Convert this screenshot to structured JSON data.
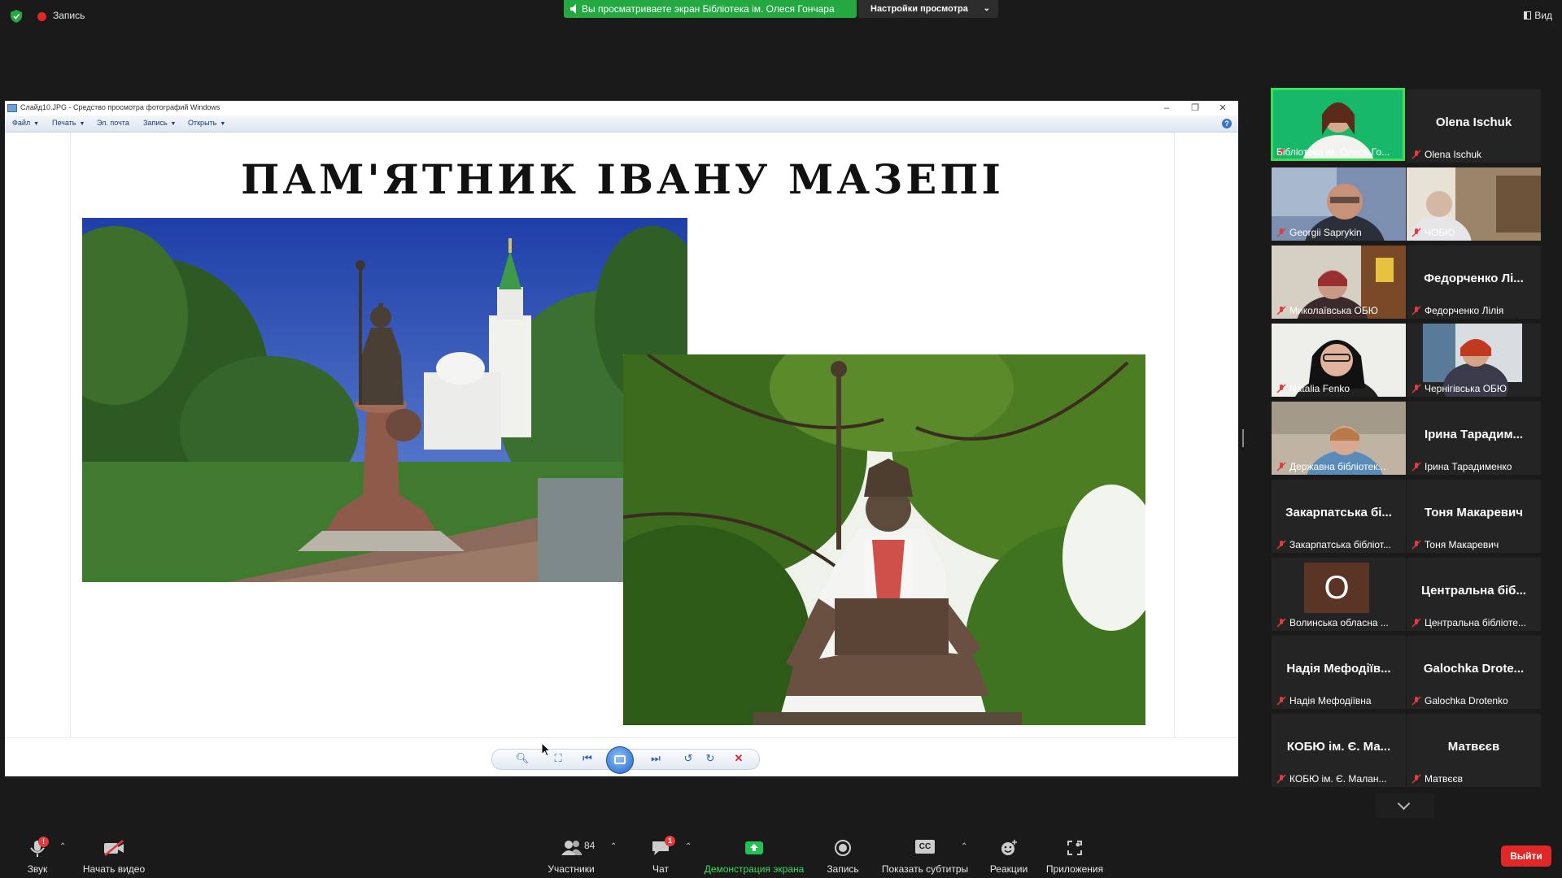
{
  "topbar": {
    "recording_label": "Запись",
    "share_banner": "Вы просматриваете экран Бібліотека ім. Олеся Гончара",
    "view_options": "Настройки просмотра",
    "view_button": "Вид"
  },
  "viewer": {
    "window_title": "Слайд10.JPG - Средство просмотра фотографий Windows",
    "menu": [
      "Файл",
      "Печать",
      "Эл. почта",
      "Запись",
      "Открыть"
    ],
    "slide_title": "ПАМ'ЯТНИК ІВАНУ МАЗЕПІ",
    "controls": [
      "zoom-icon",
      "fit-icon",
      "previous-icon",
      "slideshow-icon",
      "next-icon",
      "rotate-ccw-icon",
      "rotate-cw-icon",
      "delete-icon"
    ]
  },
  "participants": [
    {
      "name": "Бібліотека ім. Олеся Го...",
      "active": true,
      "video": true
    },
    {
      "name": "Olena Ischuk",
      "display": "Olena Ischuk",
      "video": false
    },
    {
      "name": "Georgii Saprykin",
      "video": true
    },
    {
      "name": "ЧОБЮ",
      "video": true
    },
    {
      "name": "Миколаївська ОБЮ",
      "video": true
    },
    {
      "name": "Федорченко Лілія",
      "display": "Федорченко Лі...",
      "video": false
    },
    {
      "name": "Natalia Fenko",
      "video": true
    },
    {
      "name": "Чернігівська ОБЮ",
      "video": true
    },
    {
      "name": "Державна бібліотек...",
      "video": true
    },
    {
      "name": "Ірина Тарадименко",
      "display": "Ірина Тарадим...",
      "video": false
    },
    {
      "name": "Закарпатська бібліот...",
      "display": "Закарпатська бі...",
      "video": false
    },
    {
      "name": "Тоня Макаревич",
      "display": "Тоня Макаревич",
      "video": false
    },
    {
      "name": "Волинська обласна ...",
      "display": "О",
      "video": false,
      "avatar": true
    },
    {
      "name": "Центральна бібліоте...",
      "display": "Центральна біб...",
      "video": false
    },
    {
      "name": "Надія Мефодіївна",
      "display": "Надія Мефодіїв...",
      "video": false
    },
    {
      "name": "Galochka Drotenko",
      "display": "Galochka Drote...",
      "video": false
    },
    {
      "name": "КОБЮ ім. Є. Малан...",
      "display": "КОБЮ ім. Є. Ма...",
      "video": false
    },
    {
      "name": "Матвєєв",
      "display": "Матвєєв",
      "video": false
    }
  ],
  "toolbar": {
    "audio": "Звук",
    "audio_badge": "!",
    "video": "Начать видео",
    "participants": "Участники",
    "participants_count": "84",
    "chat": "Чат",
    "chat_badge": "1",
    "share": "Демонстрация экрана",
    "record": "Запись",
    "captions": "Показать субтитры",
    "captions_icon": "CC",
    "reactions": "Реакции",
    "apps": "Приложения",
    "leave": "Выйти"
  },
  "colors": {
    "share_green": "#23a842",
    "accent_text_green": "#3ddc5a",
    "leave_red": "#e02828",
    "tile_bg": "#242424"
  }
}
